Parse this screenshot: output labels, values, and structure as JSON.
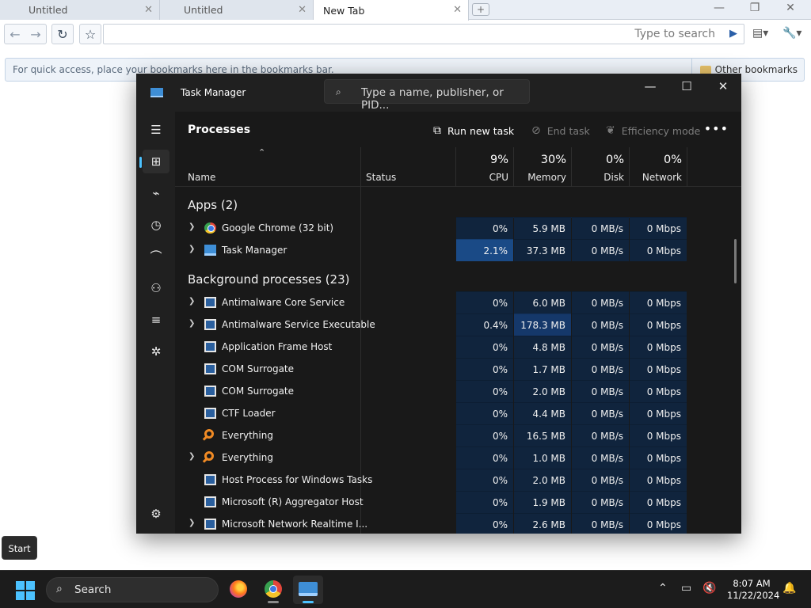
{
  "browser": {
    "tabs": [
      {
        "label": "Untitled"
      },
      {
        "label": "Untitled"
      },
      {
        "label": "New Tab"
      }
    ],
    "search_placeholder": "Type to search",
    "bookmarks_hint": "For quick access, place your bookmarks here in the bookmarks bar.",
    "other_bookmarks": "Other bookmarks"
  },
  "task_manager": {
    "title": "Task Manager",
    "search_placeholder": "Type a name, publisher, or PID...",
    "heading": "Processes",
    "actions": {
      "run_new_task": "Run new task",
      "end_task": "End task",
      "efficiency_mode": "Efficiency mode"
    },
    "columns": {
      "name": "Name",
      "status": "Status",
      "cpu": {
        "pct": "9%",
        "label": "CPU"
      },
      "memory": {
        "pct": "30%",
        "label": "Memory"
      },
      "disk": {
        "pct": "0%",
        "label": "Disk"
      },
      "network": {
        "pct": "0%",
        "label": "Network"
      }
    },
    "groups": {
      "apps": "Apps (2)",
      "background": "Background processes (23)"
    },
    "apps": [
      {
        "name": "Google Chrome (32 bit)",
        "icon": "chrome-icon",
        "cpu": "0%",
        "memory": "5.9 MB",
        "disk": "0 MB/s",
        "network": "0 Mbps"
      },
      {
        "name": "Task Manager",
        "icon": "task-manager-icon",
        "cpu": "2.1%",
        "memory": "37.3 MB",
        "disk": "0 MB/s",
        "network": "0 Mbps"
      }
    ],
    "background": [
      {
        "name": "Antimalware Core Service",
        "cpu": "0%",
        "memory": "6.0 MB",
        "disk": "0 MB/s",
        "network": "0 Mbps"
      },
      {
        "name": "Antimalware Service Executable",
        "cpu": "0.4%",
        "memory": "178.3 MB",
        "disk": "0 MB/s",
        "network": "0 Mbps"
      },
      {
        "name": "Application Frame Host",
        "cpu": "0%",
        "memory": "4.8 MB",
        "disk": "0 MB/s",
        "network": "0 Mbps"
      },
      {
        "name": "COM Surrogate",
        "cpu": "0%",
        "memory": "1.7 MB",
        "disk": "0 MB/s",
        "network": "0 Mbps"
      },
      {
        "name": "COM Surrogate",
        "cpu": "0%",
        "memory": "2.0 MB",
        "disk": "0 MB/s",
        "network": "0 Mbps"
      },
      {
        "name": "CTF Loader",
        "cpu": "0%",
        "memory": "4.4 MB",
        "disk": "0 MB/s",
        "network": "0 Mbps"
      },
      {
        "name": "Everything",
        "cpu": "0%",
        "memory": "16.5 MB",
        "disk": "0 MB/s",
        "network": "0 Mbps"
      },
      {
        "name": "Everything",
        "cpu": "0%",
        "memory": "1.0 MB",
        "disk": "0 MB/s",
        "network": "0 Mbps"
      },
      {
        "name": "Host Process for Windows Tasks",
        "cpu": "0%",
        "memory": "2.0 MB",
        "disk": "0 MB/s",
        "network": "0 Mbps"
      },
      {
        "name": "Microsoft (R) Aggregator Host",
        "cpu": "0%",
        "memory": "1.9 MB",
        "disk": "0 MB/s",
        "network": "0 Mbps"
      },
      {
        "name": "Microsoft Network Realtime I...",
        "cpu": "0%",
        "memory": "2.6 MB",
        "disk": "0 MB/s",
        "network": "0 Mbps"
      }
    ]
  },
  "tooltip": {
    "start": "Start"
  },
  "taskbar": {
    "search_label": "Search",
    "time": "8:07 AM",
    "date": "11/22/2024"
  },
  "colors": {
    "accent": "#4cc2ff",
    "tm_bg": "#202020",
    "heat_low": "#10243d",
    "heat_mid": "#15386a"
  }
}
